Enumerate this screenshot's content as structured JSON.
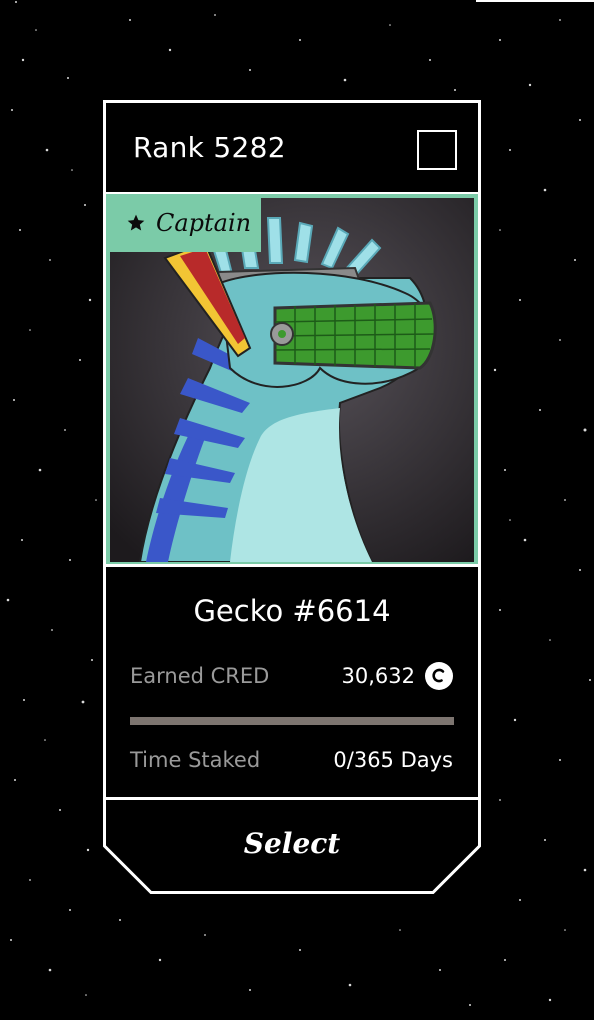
{
  "card": {
    "rank": "Rank 5282",
    "badge": {
      "label": "Captain",
      "icon": "star-icon"
    },
    "name": "Gecko #6614",
    "earned": {
      "label": "Earned CRED",
      "value": "30,632",
      "icon": "cred-coin-icon"
    },
    "time": {
      "label": "Time Staked",
      "value": "0/365 Days"
    },
    "progress_fraction": 0,
    "select_label": "Select"
  },
  "colors": {
    "background": "#000000",
    "accent": "#7bcba8",
    "progress_track": "#7d7570",
    "muted_text": "#9a9a9a"
  }
}
